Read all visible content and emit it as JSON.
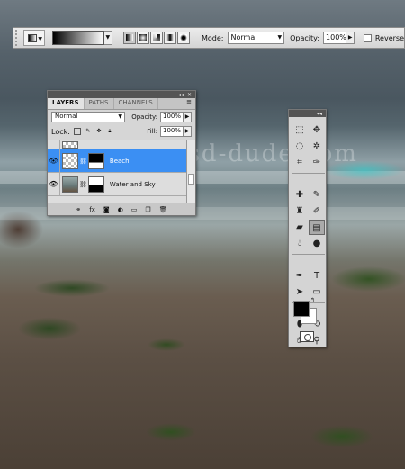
{
  "options_bar": {
    "mode_label": "Mode:",
    "mode_value": "Normal",
    "opacity_label": "Opacity:",
    "opacity_value": "100%",
    "reverse_label": "Reverse"
  },
  "watermark": "www.psd-dude.com",
  "layers_panel": {
    "tabs": [
      "LAYERS",
      "PATHS",
      "CHANNELS"
    ],
    "blend_mode": "Normal",
    "opacity_label": "Opacity:",
    "opacity_value": "100%",
    "lock_label": "Lock:",
    "fill_label": "Fill:",
    "fill_value": "100%",
    "layers": [
      {
        "name": "",
        "selected": false
      },
      {
        "name": "Beach",
        "selected": true
      },
      {
        "name": "Water and Sky",
        "selected": false
      }
    ]
  },
  "colors": {
    "selection": "#3b8ff3",
    "foreground": "#000000",
    "background": "#ffffff"
  }
}
